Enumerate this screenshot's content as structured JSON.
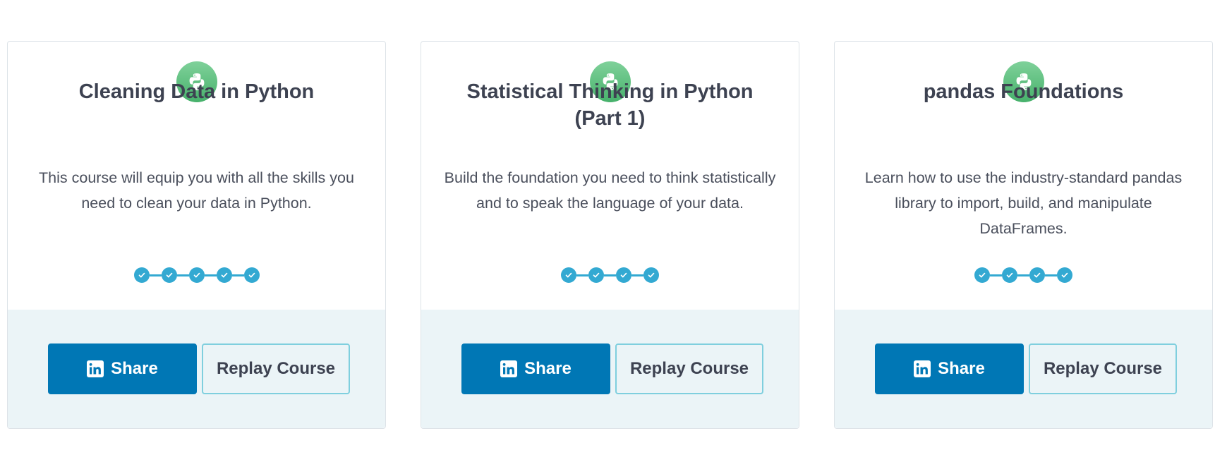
{
  "colors": {
    "python_badge": "#4fb874",
    "progress": "#33a9d2",
    "linkedin": "#0077b5",
    "footer_bg": "#ebf4f7"
  },
  "icons": {
    "badge": "python-logo-icon",
    "progress": "check-icon",
    "share": "linkedin-icon"
  },
  "courses": [
    {
      "title": "Cleaning Data in Python",
      "description": "This course will equip you with all the skills you need to clean your data in Python.",
      "chapters_completed": 5,
      "share_label": "Share",
      "replay_label": "Replay Course"
    },
    {
      "title": "Statistical Thinking in Python (Part 1)",
      "description": "Build the foundation you need to think statistically and to speak the language of your data.",
      "chapters_completed": 4,
      "share_label": "Share",
      "replay_label": "Replay Course"
    },
    {
      "title": "pandas Foundations",
      "description": "Learn how to use the industry-standard pandas library to import, build, and manipulate DataFrames.",
      "chapters_completed": 4,
      "share_label": "Share",
      "replay_label": "Replay Course"
    }
  ]
}
